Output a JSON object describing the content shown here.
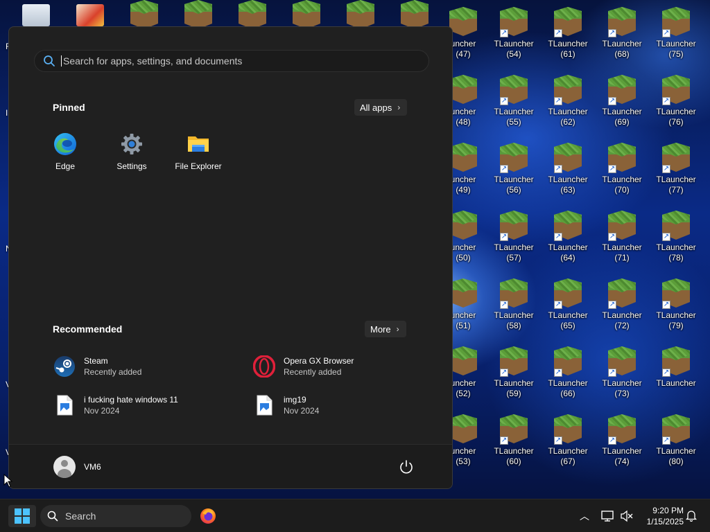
{
  "start_menu": {
    "search_placeholder": "Search for apps, settings, and documents",
    "pinned_title": "Pinned",
    "all_apps_label": "All apps",
    "pinned": [
      {
        "label": "Edge",
        "icon": "edge-icon"
      },
      {
        "label": "Settings",
        "icon": "gear-icon"
      },
      {
        "label": "File Explorer",
        "icon": "folder-icon"
      }
    ],
    "recommended_title": "Recommended",
    "more_label": "More",
    "recommended": [
      {
        "title": "Steam",
        "subtitle": "Recently added",
        "icon": "steam-icon"
      },
      {
        "title": "Opera GX Browser",
        "subtitle": "Recently added",
        "icon": "opera-icon"
      },
      {
        "title": "i fucking hate windows 11",
        "subtitle": "Nov 2024",
        "icon": "image-file-icon"
      },
      {
        "title": "img19",
        "subtitle": "Nov 2024",
        "icon": "image-file-icon"
      }
    ],
    "user_name": "VM6"
  },
  "taskbar": {
    "search_label": "Search",
    "time": "9:20 PM",
    "date": "1/15/2025"
  },
  "desktop": {
    "partial_column": [
      "uncher\n(47)",
      "uncher\n(48)",
      "uncher\n(49)",
      "uncher\n(50)",
      "uncher\n(51)",
      "uncher\n(52)",
      "uncher\n(53)"
    ],
    "columns": [
      [
        "TLauncher\n(54)",
        "TLauncher\n(55)",
        "TLauncher\n(56)",
        "TLauncher\n(57)",
        "TLauncher\n(58)",
        "TLauncher\n(59)",
        "TLauncher\n(60)"
      ],
      [
        "TLauncher\n(61)",
        "TLauncher\n(62)",
        "TLauncher\n(63)",
        "TLauncher\n(64)",
        "TLauncher\n(65)",
        "TLauncher\n(66)",
        "TLauncher\n(67)"
      ],
      [
        "TLauncher\n(68)",
        "TLauncher\n(69)",
        "TLauncher\n(70)",
        "TLauncher\n(71)",
        "TLauncher\n(72)",
        "TLauncher\n(73)",
        "TLauncher\n(74)"
      ],
      [
        "TLauncher\n(75)",
        "TLauncher\n(76)",
        "TLauncher\n(77)",
        "TLauncher\n(78)",
        "TLauncher\n(79)",
        "TLauncher",
        "TLauncher\n(80)"
      ]
    ],
    "edge_chars": [
      "R",
      "I",
      "N",
      "V",
      "V"
    ]
  },
  "colors": {
    "accent": "#0078d4",
    "start_bg": "#202020",
    "taskbar_bg": "#1c1c1c"
  }
}
